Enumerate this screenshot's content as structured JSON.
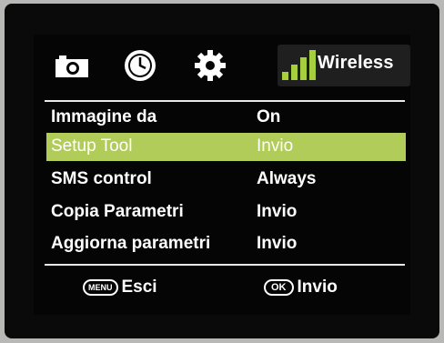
{
  "header": {
    "tabs": [
      {
        "icon": "camera-icon"
      },
      {
        "icon": "clock-icon"
      },
      {
        "icon": "gear-icon"
      },
      {
        "icon": "signal-bars-icon",
        "label": "Wireless"
      }
    ]
  },
  "menu": {
    "items": [
      {
        "label": "Immagine da",
        "value": "On"
      },
      {
        "label": "Setup Tool",
        "value": "Invio",
        "selected": true
      },
      {
        "label": "SMS control",
        "value": "Always"
      },
      {
        "label": "Copia Parametri",
        "value": "Invio"
      },
      {
        "label": "Aggiorna parametri",
        "value": "Invio"
      }
    ]
  },
  "footer": {
    "menu_key": "MENU",
    "menu_action": "Esci",
    "ok_key": "OK",
    "ok_action": "Invio"
  },
  "colors": {
    "highlight": "#b2cc59",
    "signal": "#a5cf3f",
    "text": "#ffffff",
    "background": "#050505"
  }
}
